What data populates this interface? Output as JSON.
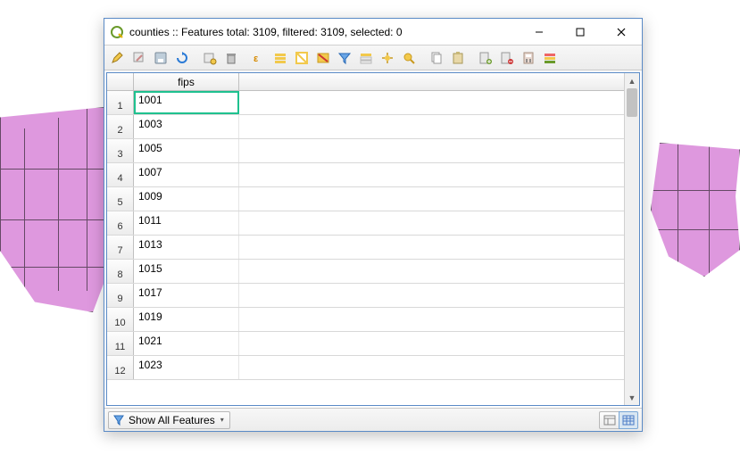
{
  "window": {
    "title": "counties :: Features total: 3109, filtered: 3109, selected: 0"
  },
  "table": {
    "column_header": "fips",
    "selected_row_index": 0,
    "rows": [
      {
        "n": "1",
        "fips": "1001"
      },
      {
        "n": "2",
        "fips": "1003"
      },
      {
        "n": "3",
        "fips": "1005"
      },
      {
        "n": "4",
        "fips": "1007"
      },
      {
        "n": "5",
        "fips": "1009"
      },
      {
        "n": "6",
        "fips": "1011"
      },
      {
        "n": "7",
        "fips": "1013"
      },
      {
        "n": "8",
        "fips": "1015"
      },
      {
        "n": "9",
        "fips": "1017"
      },
      {
        "n": "10",
        "fips": "1019"
      },
      {
        "n": "11",
        "fips": "1021"
      },
      {
        "n": "12",
        "fips": "1023"
      }
    ]
  },
  "statusbar": {
    "filter_label": "Show All Features"
  },
  "toolbar_icons": [
    "pencil-icon",
    "multiedit-icon",
    "save-icon",
    "refresh-icon",
    "new-field-icon",
    "delete-icon",
    "cut-icon",
    "select-all-icon",
    "invert-selection-icon",
    "deselect-icon",
    "filter-selection-icon",
    "move-top-icon",
    "pan-to-icon",
    "zoom-to-icon",
    "copy-icon",
    "paste-icon",
    "new-column-icon",
    "delete-column-icon",
    "field-calc-icon",
    "conditional-format-icon"
  ]
}
